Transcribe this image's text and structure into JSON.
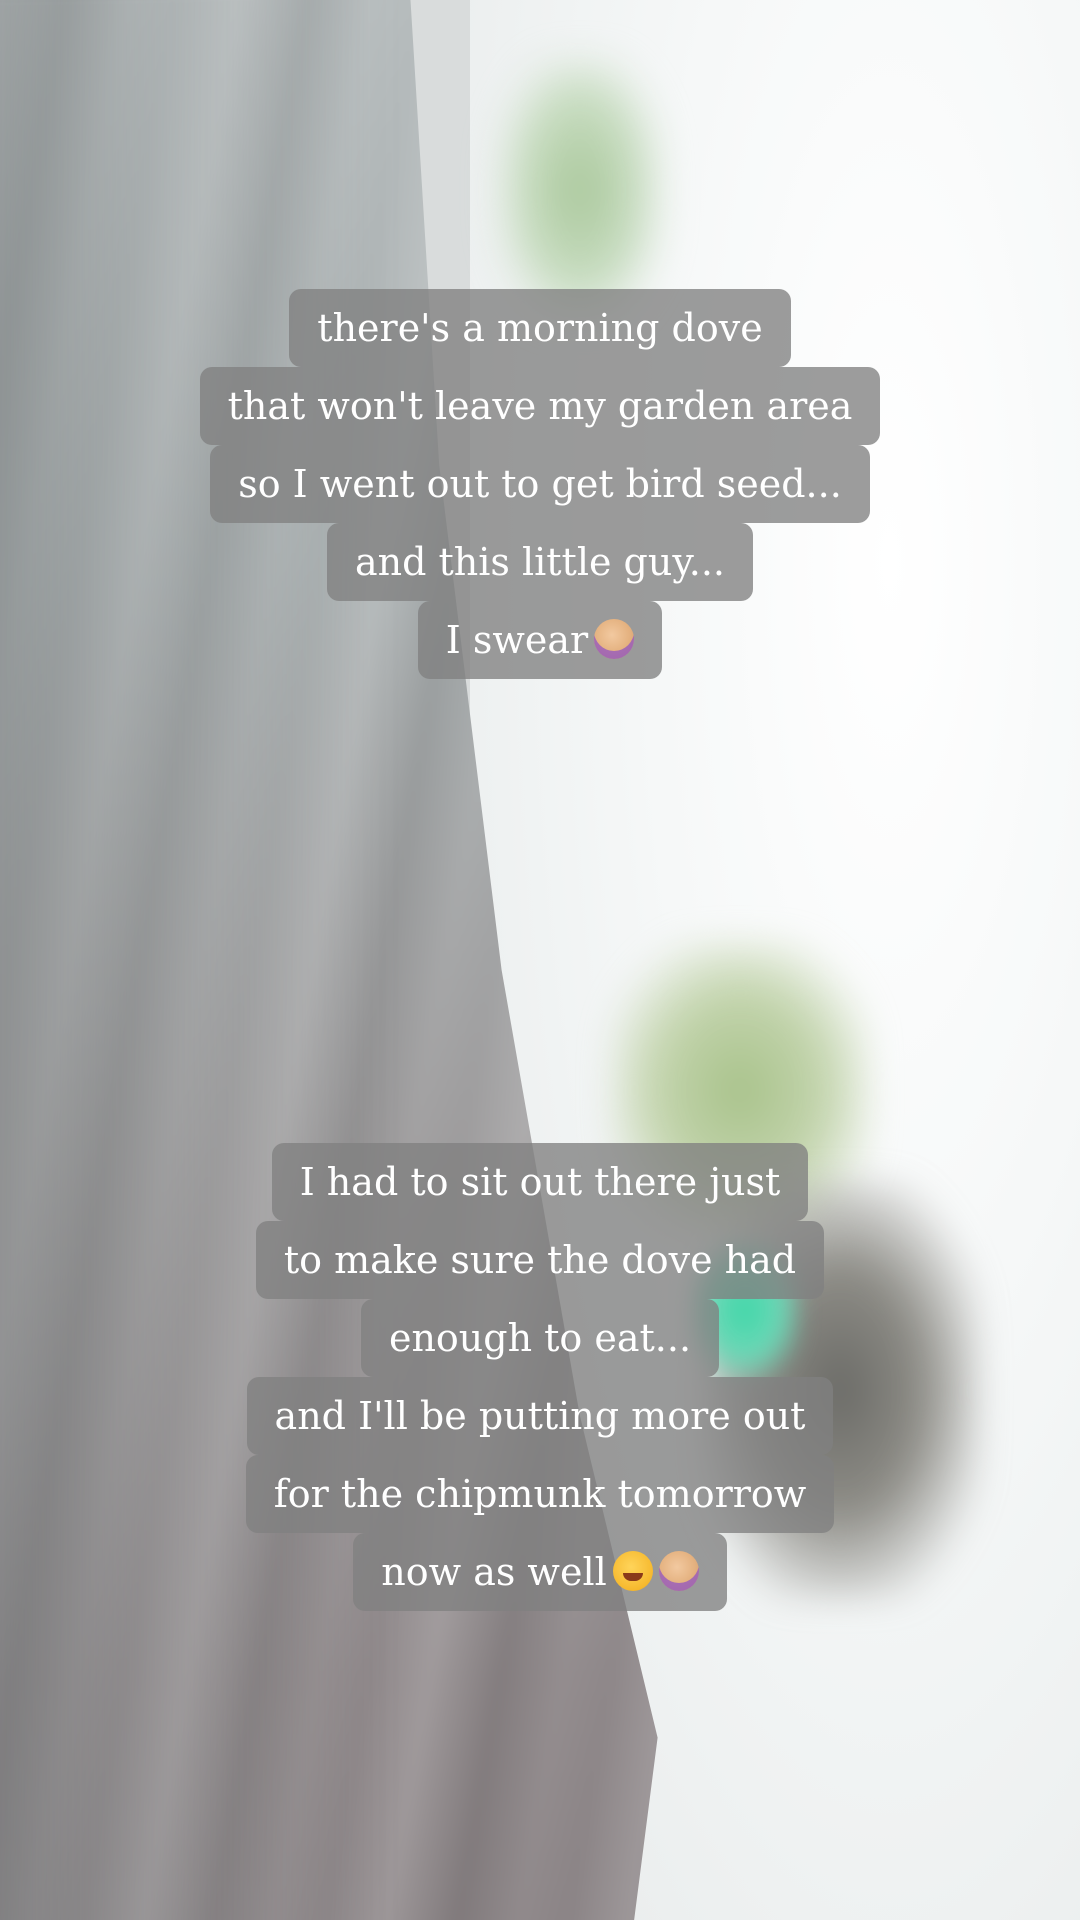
{
  "story": {
    "caption_1": {
      "lines": [
        "there's a morning dove",
        "that won't leave my garden area",
        "so I went out to get bird seed...",
        "and this little guy...",
        "I swear"
      ],
      "trailing_emoji": [
        "woman-facepalming-icon"
      ]
    },
    "caption_2": {
      "lines": [
        "I had to sit out there just",
        "to make sure the dove had",
        "enough to eat...",
        "and I'll be putting more out",
        "for the chipmunk tomorrow",
        "now as well"
      ],
      "trailing_emoji": [
        "grinning-face-with-sweat-icon",
        "woman-facepalming-icon"
      ]
    },
    "colors": {
      "caption_bg": "#808080",
      "caption_text": "#ffffff"
    }
  }
}
